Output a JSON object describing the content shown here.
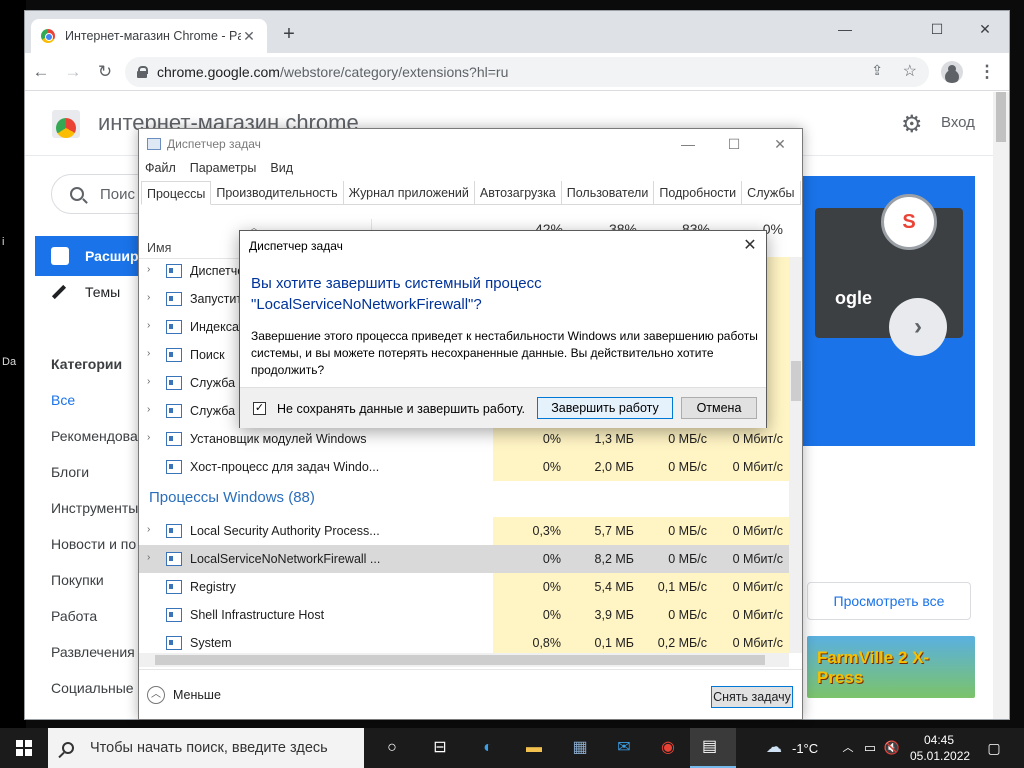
{
  "desktop": {
    "edge_texts": [
      "i",
      "Da"
    ]
  },
  "chrome": {
    "tab_title": "Интернет-магазин Chrome - Pa",
    "url_host": "chrome.google.com",
    "url_path": "/webstore/category/extensions?hl=ru",
    "page": {
      "store_title": "интернет-магазин chrome",
      "login": "Вход",
      "search_placeholder": "Поис",
      "nav_extensions": "Расшир",
      "nav_themes": "Темы",
      "categories_heading": "Категории",
      "categories": [
        "Все",
        "Рекомендова",
        "Блоги",
        "Инструменты",
        "Новости и по",
        "Покупки",
        "Работа",
        "Развлечения",
        "Социальные"
      ],
      "banner_text": "ogle",
      "view_all": "Просмотреть все",
      "promo_text": "FarmVille 2 X-Press"
    }
  },
  "taskmgr": {
    "title": "Диспетчер задач",
    "menu": [
      "Файл",
      "Параметры",
      "Вид"
    ],
    "tabs": [
      "Процессы",
      "Производительность",
      "Журнал приложений",
      "Автозагрузка",
      "Пользователи",
      "Подробности",
      "Службы"
    ],
    "col_name": "Имя",
    "col_pcts": [
      "42%",
      "38%",
      "83%",
      "0%"
    ],
    "rows_top": [
      {
        "name": "Диспетче",
        "cpu": "",
        "mem": "",
        "disk": "",
        "net": "",
        "exp": true
      },
      {
        "name": "Запустит",
        "cpu": "",
        "mem": "",
        "disk": "",
        "net": "",
        "exp": true
      },
      {
        "name": "Индексат",
        "cpu": "",
        "mem": "",
        "disk": "",
        "net": "",
        "exp": true
      },
      {
        "name": "Поиск",
        "cpu": "",
        "mem": "",
        "disk": "",
        "net": "",
        "exp": true
      },
      {
        "name": "Служба б",
        "cpu": "",
        "mem": "",
        "disk": "",
        "net": "",
        "exp": true
      },
      {
        "name": "Служба п",
        "cpu": "",
        "mem": "",
        "disk": "",
        "net": "",
        "exp": true
      },
      {
        "name": "Установщик модулей Windows",
        "cpu": "0%",
        "mem": "1,3 МБ",
        "disk": "0 МБ/с",
        "net": "0 Мбит/с",
        "exp": true
      },
      {
        "name": "Хост-процесс для задач Windo...",
        "cpu": "0%",
        "mem": "2,0 МБ",
        "disk": "0 МБ/с",
        "net": "0 Мбит/с",
        "exp": false
      }
    ],
    "group_title": "Процессы Windows (88)",
    "rows_windows": [
      {
        "name": "Local Security Authority Process...",
        "cpu": "0,3%",
        "mem": "5,7 МБ",
        "disk": "0 МБ/с",
        "net": "0 Мбит/с",
        "exp": true
      },
      {
        "name": "LocalServiceNoNetworkFirewall ...",
        "cpu": "0%",
        "mem": "8,2 МБ",
        "disk": "0 МБ/с",
        "net": "0 Мбит/с",
        "exp": true,
        "selected": true
      },
      {
        "name": "Registry",
        "cpu": "0%",
        "mem": "5,4 МБ",
        "disk": "0,1 МБ/с",
        "net": "0 Мбит/с",
        "exp": false
      },
      {
        "name": "Shell Infrastructure Host",
        "cpu": "0%",
        "mem": "3,9 МБ",
        "disk": "0 МБ/с",
        "net": "0 Мбит/с",
        "exp": false
      },
      {
        "name": "System",
        "cpu": "0,8%",
        "mem": "0,1 МБ",
        "disk": "0,2 МБ/с",
        "net": "0 Мбит/с",
        "exp": false
      }
    ],
    "less_label": "Меньше",
    "end_task_label": "Снять задачу"
  },
  "dialog": {
    "title": "Диспетчер задач",
    "question": "Вы хотите завершить системный процесс \"LocalServiceNoNetworkFirewall\"?",
    "body": "Завершение этого процесса приведет к нестабильности Windows или завершению работы системы, и вы можете потерять несохраненные данные. Вы действительно хотите продолжить?",
    "checkbox_label": "Не сохранять данные и завершить работу.",
    "checkbox_checked": true,
    "confirm_label": "Завершить работу",
    "cancel_label": "Отмена"
  },
  "taskbar": {
    "search_placeholder": "Чтобы начать поиск, введите здесь",
    "weather": "-1°C",
    "time": "04:45",
    "date": "05.01.2022"
  }
}
